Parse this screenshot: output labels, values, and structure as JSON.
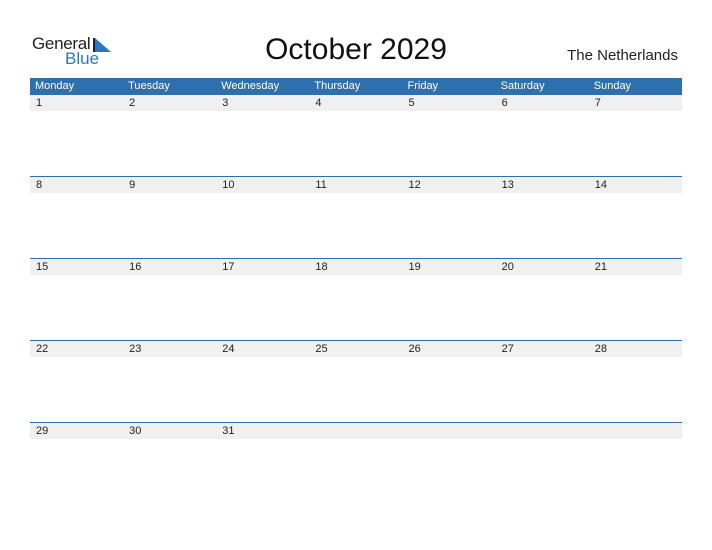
{
  "logo": {
    "part1": "General",
    "part2": "Blue"
  },
  "title": "October 2029",
  "country": "The Netherlands",
  "colors": {
    "accent": "#2e6fad",
    "band": "#f0f0f0",
    "logo_blue": "#2a78c4"
  },
  "weekdays": [
    "Monday",
    "Tuesday",
    "Wednesday",
    "Thursday",
    "Friday",
    "Saturday",
    "Sunday"
  ],
  "weeks": [
    [
      "1",
      "2",
      "3",
      "4",
      "5",
      "6",
      "7"
    ],
    [
      "8",
      "9",
      "10",
      "11",
      "12",
      "13",
      "14"
    ],
    [
      "15",
      "16",
      "17",
      "18",
      "19",
      "20",
      "21"
    ],
    [
      "22",
      "23",
      "24",
      "25",
      "26",
      "27",
      "28"
    ],
    [
      "29",
      "30",
      "31",
      "",
      "",
      "",
      ""
    ]
  ]
}
